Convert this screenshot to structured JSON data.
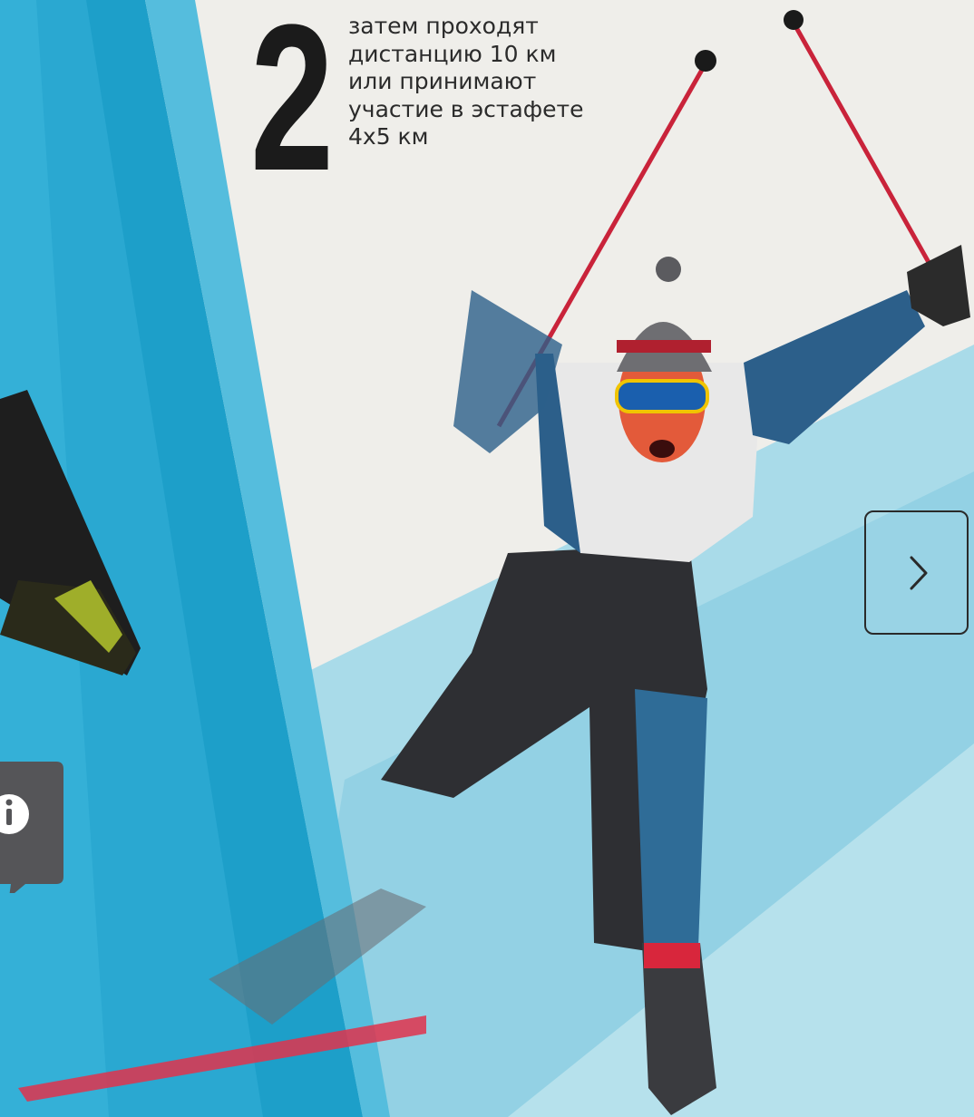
{
  "step": {
    "number": "2",
    "lines": [
      "затем проходят",
      "дистанцию 10 км",
      "или принимают",
      "участие в эстафете",
      "4x5 км"
    ]
  },
  "controls": {
    "next_icon": "chevron-right-icon",
    "info_icon": "info-icon"
  },
  "colors": {
    "background_light": "#efeeea",
    "blue_dark": "#1d9fc9",
    "blue_mid": "#49b8d9",
    "blue_light": "#a7dbe9",
    "accent_red": "#d81e3c",
    "text_dark": "#1b1b1b"
  }
}
